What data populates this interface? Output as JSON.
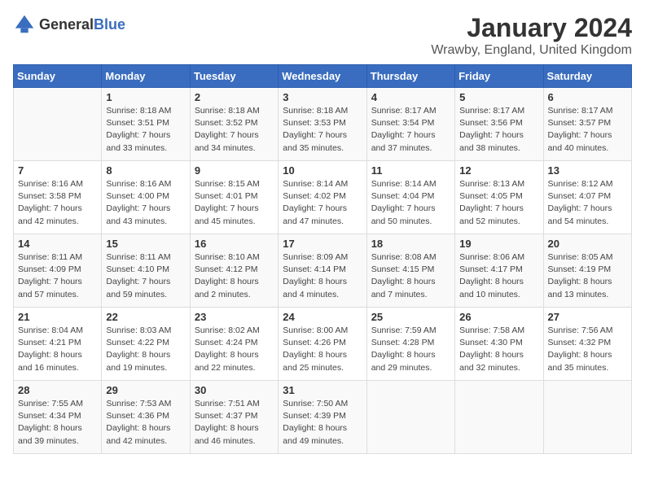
{
  "header": {
    "logo_general": "General",
    "logo_blue": "Blue",
    "month_title": "January 2024",
    "location": "Wrawby, England, United Kingdom"
  },
  "days_of_week": [
    "Sunday",
    "Monday",
    "Tuesday",
    "Wednesday",
    "Thursday",
    "Friday",
    "Saturday"
  ],
  "weeks": [
    [
      {
        "day": "",
        "detail": ""
      },
      {
        "day": "1",
        "detail": "Sunrise: 8:18 AM\nSunset: 3:51 PM\nDaylight: 7 hours\nand 33 minutes."
      },
      {
        "day": "2",
        "detail": "Sunrise: 8:18 AM\nSunset: 3:52 PM\nDaylight: 7 hours\nand 34 minutes."
      },
      {
        "day": "3",
        "detail": "Sunrise: 8:18 AM\nSunset: 3:53 PM\nDaylight: 7 hours\nand 35 minutes."
      },
      {
        "day": "4",
        "detail": "Sunrise: 8:17 AM\nSunset: 3:54 PM\nDaylight: 7 hours\nand 37 minutes."
      },
      {
        "day": "5",
        "detail": "Sunrise: 8:17 AM\nSunset: 3:56 PM\nDaylight: 7 hours\nand 38 minutes."
      },
      {
        "day": "6",
        "detail": "Sunrise: 8:17 AM\nSunset: 3:57 PM\nDaylight: 7 hours\nand 40 minutes."
      }
    ],
    [
      {
        "day": "7",
        "detail": "Sunrise: 8:16 AM\nSunset: 3:58 PM\nDaylight: 7 hours\nand 42 minutes."
      },
      {
        "day": "8",
        "detail": "Sunrise: 8:16 AM\nSunset: 4:00 PM\nDaylight: 7 hours\nand 43 minutes."
      },
      {
        "day": "9",
        "detail": "Sunrise: 8:15 AM\nSunset: 4:01 PM\nDaylight: 7 hours\nand 45 minutes."
      },
      {
        "day": "10",
        "detail": "Sunrise: 8:14 AM\nSunset: 4:02 PM\nDaylight: 7 hours\nand 47 minutes."
      },
      {
        "day": "11",
        "detail": "Sunrise: 8:14 AM\nSunset: 4:04 PM\nDaylight: 7 hours\nand 50 minutes."
      },
      {
        "day": "12",
        "detail": "Sunrise: 8:13 AM\nSunset: 4:05 PM\nDaylight: 7 hours\nand 52 minutes."
      },
      {
        "day": "13",
        "detail": "Sunrise: 8:12 AM\nSunset: 4:07 PM\nDaylight: 7 hours\nand 54 minutes."
      }
    ],
    [
      {
        "day": "14",
        "detail": "Sunrise: 8:11 AM\nSunset: 4:09 PM\nDaylight: 7 hours\nand 57 minutes."
      },
      {
        "day": "15",
        "detail": "Sunrise: 8:11 AM\nSunset: 4:10 PM\nDaylight: 7 hours\nand 59 minutes."
      },
      {
        "day": "16",
        "detail": "Sunrise: 8:10 AM\nSunset: 4:12 PM\nDaylight: 8 hours\nand 2 minutes."
      },
      {
        "day": "17",
        "detail": "Sunrise: 8:09 AM\nSunset: 4:14 PM\nDaylight: 8 hours\nand 4 minutes."
      },
      {
        "day": "18",
        "detail": "Sunrise: 8:08 AM\nSunset: 4:15 PM\nDaylight: 8 hours\nand 7 minutes."
      },
      {
        "day": "19",
        "detail": "Sunrise: 8:06 AM\nSunset: 4:17 PM\nDaylight: 8 hours\nand 10 minutes."
      },
      {
        "day": "20",
        "detail": "Sunrise: 8:05 AM\nSunset: 4:19 PM\nDaylight: 8 hours\nand 13 minutes."
      }
    ],
    [
      {
        "day": "21",
        "detail": "Sunrise: 8:04 AM\nSunset: 4:21 PM\nDaylight: 8 hours\nand 16 minutes."
      },
      {
        "day": "22",
        "detail": "Sunrise: 8:03 AM\nSunset: 4:22 PM\nDaylight: 8 hours\nand 19 minutes."
      },
      {
        "day": "23",
        "detail": "Sunrise: 8:02 AM\nSunset: 4:24 PM\nDaylight: 8 hours\nand 22 minutes."
      },
      {
        "day": "24",
        "detail": "Sunrise: 8:00 AM\nSunset: 4:26 PM\nDaylight: 8 hours\nand 25 minutes."
      },
      {
        "day": "25",
        "detail": "Sunrise: 7:59 AM\nSunset: 4:28 PM\nDaylight: 8 hours\nand 29 minutes."
      },
      {
        "day": "26",
        "detail": "Sunrise: 7:58 AM\nSunset: 4:30 PM\nDaylight: 8 hours\nand 32 minutes."
      },
      {
        "day": "27",
        "detail": "Sunrise: 7:56 AM\nSunset: 4:32 PM\nDaylight: 8 hours\nand 35 minutes."
      }
    ],
    [
      {
        "day": "28",
        "detail": "Sunrise: 7:55 AM\nSunset: 4:34 PM\nDaylight: 8 hours\nand 39 minutes."
      },
      {
        "day": "29",
        "detail": "Sunrise: 7:53 AM\nSunset: 4:36 PM\nDaylight: 8 hours\nand 42 minutes."
      },
      {
        "day": "30",
        "detail": "Sunrise: 7:51 AM\nSunset: 4:37 PM\nDaylight: 8 hours\nand 46 minutes."
      },
      {
        "day": "31",
        "detail": "Sunrise: 7:50 AM\nSunset: 4:39 PM\nDaylight: 8 hours\nand 49 minutes."
      },
      {
        "day": "",
        "detail": ""
      },
      {
        "day": "",
        "detail": ""
      },
      {
        "day": "",
        "detail": ""
      }
    ]
  ]
}
